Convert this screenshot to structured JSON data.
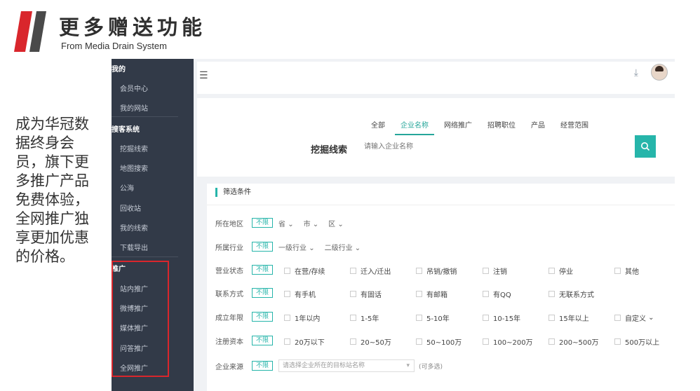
{
  "slide": {
    "title": "更多赠送功能",
    "subtitle": "From Media Drain System",
    "side_text": "成为华冠数据终身会员，旗下更多推广产品免费体验，全网推广独享更加优惠的价格。",
    "accent_color": "#d9262c"
  },
  "sidebar": {
    "sections": [
      {
        "label": "我的",
        "items": [
          "会员中心",
          "我的网站"
        ]
      },
      {
        "label": "搜客系统",
        "items": [
          "挖掘线索",
          "地图搜索",
          "公海",
          "回收站",
          "我的线索",
          "下载导出"
        ]
      },
      {
        "label": "推广",
        "items": [
          "站内推广",
          "微博推广",
          "媒体推广",
          "问答推广",
          "全网推广"
        ]
      }
    ]
  },
  "topbar": {
    "menu_icon": "menu-icon",
    "download_icon": "download-icon"
  },
  "search": {
    "tabs": [
      "全部",
      "企业名称",
      "网络推广",
      "招聘职位",
      "产品",
      "经营范围"
    ],
    "active_tab": "企业名称",
    "label": "挖掘线索",
    "placeholder": "请输入企业名称",
    "button_icon": "search-icon",
    "accent_color": "#26b5aa"
  },
  "filters": {
    "title": "筛选条件",
    "no_limit": "不限",
    "rows": [
      {
        "label": "所在地区",
        "drops": [
          "省",
          "市",
          "区"
        ],
        "options": []
      },
      {
        "label": "所属行业",
        "drops": [
          "一级行业",
          "二级行业"
        ],
        "options": []
      },
      {
        "label": "营业状态",
        "drops": [],
        "options": [
          "在营/存续",
          "迁入/迁出",
          "吊销/撤销",
          "注销",
          "停业",
          "其他"
        ]
      },
      {
        "label": "联系方式",
        "drops": [],
        "options": [
          "有手机",
          "有固话",
          "有邮箱",
          "有QQ",
          "无联系方式"
        ]
      },
      {
        "label": "成立年限",
        "drops": [],
        "options": [
          "1年以内",
          "1-5年",
          "5-10年",
          "10-15年",
          "15年以上",
          "自定义"
        ]
      },
      {
        "label": "注册资本",
        "drops": [],
        "options": [
          "20万以下",
          "20~50万",
          "50~100万",
          "100~200万",
          "200~500万",
          "500万以上"
        ]
      }
    ],
    "source": {
      "label": "企业来源",
      "placeholder": "请选择企业所在的目标站名称",
      "hint": "(可多选)"
    }
  }
}
